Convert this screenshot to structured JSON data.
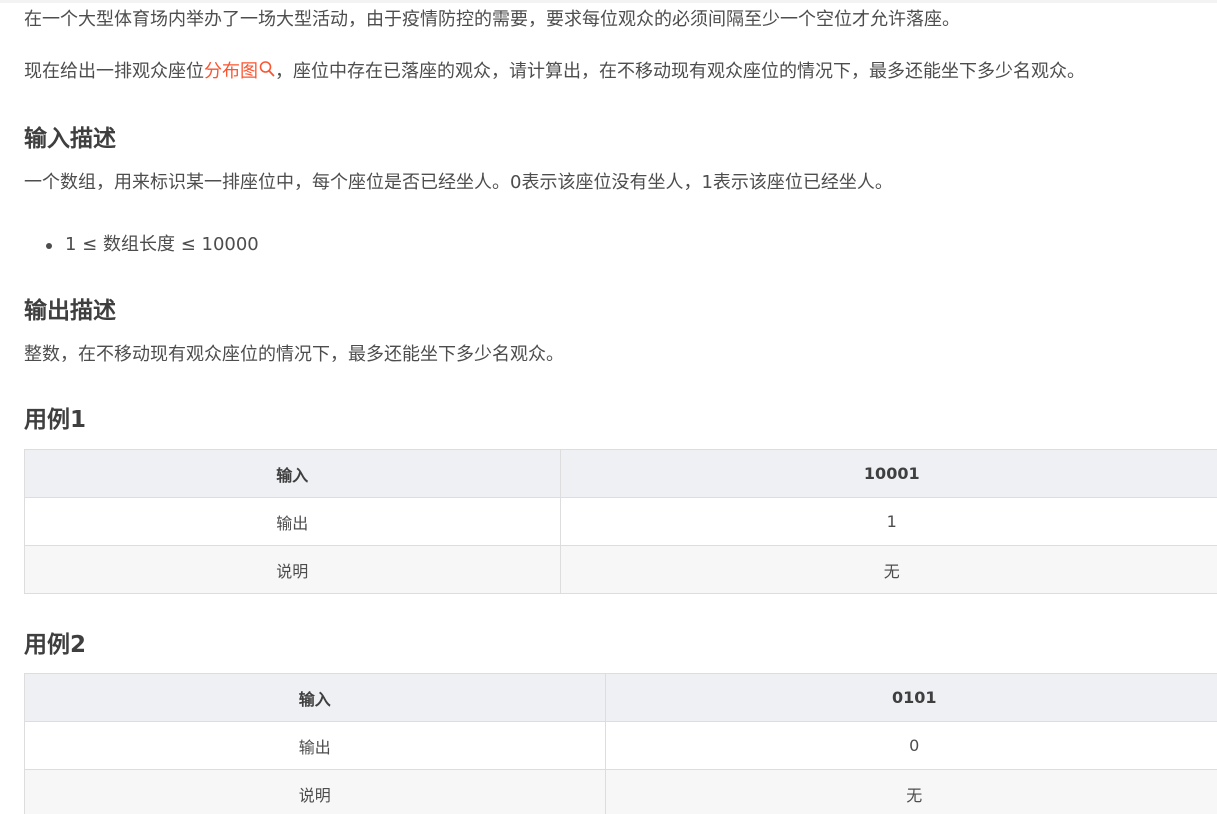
{
  "intro": {
    "line1": "在一个大型体育场内举办了一场大型活动，由于疫情防控的需要，要求每位观众的必须间隔至少一个空位才允许落座。",
    "line2_before": "现在给出一排观众座位",
    "line2_link": "分布图",
    "line2_after": "，座位中存在已落座的观众，请计算出，在不移动现有观众座位的情况下，最多还能坐下多少名观众。"
  },
  "input_section": {
    "heading": "输入描述",
    "text": "一个数组，用来标识某一排座位中，每个座位是否已经坐人。0表示该座位没有坐人，1表示该座位已经坐人。",
    "bullets": [
      "1 ≤ 数组长度 ≤ 10000"
    ]
  },
  "output_section": {
    "heading": "输出描述",
    "text": "整数，在不移动现有观众座位的情况下，最多还能坐下多少名观众。"
  },
  "examples": [
    {
      "heading": "用例1",
      "rows": [
        {
          "label": "输入",
          "value": "10001"
        },
        {
          "label": "输出",
          "value": "1"
        },
        {
          "label": "说明",
          "value": "无"
        }
      ]
    },
    {
      "heading": "用例2",
      "rows": [
        {
          "label": "输入",
          "value": "0101"
        },
        {
          "label": "输出",
          "value": "0"
        },
        {
          "label": "说明",
          "value": "无"
        }
      ]
    }
  ],
  "colors": {
    "link": "#fc5531",
    "text": "#4d4d4d",
    "table_header_bg": "#eef0f4",
    "table_border": "#dddddd"
  },
  "icons": {
    "link_search": "search-icon"
  }
}
